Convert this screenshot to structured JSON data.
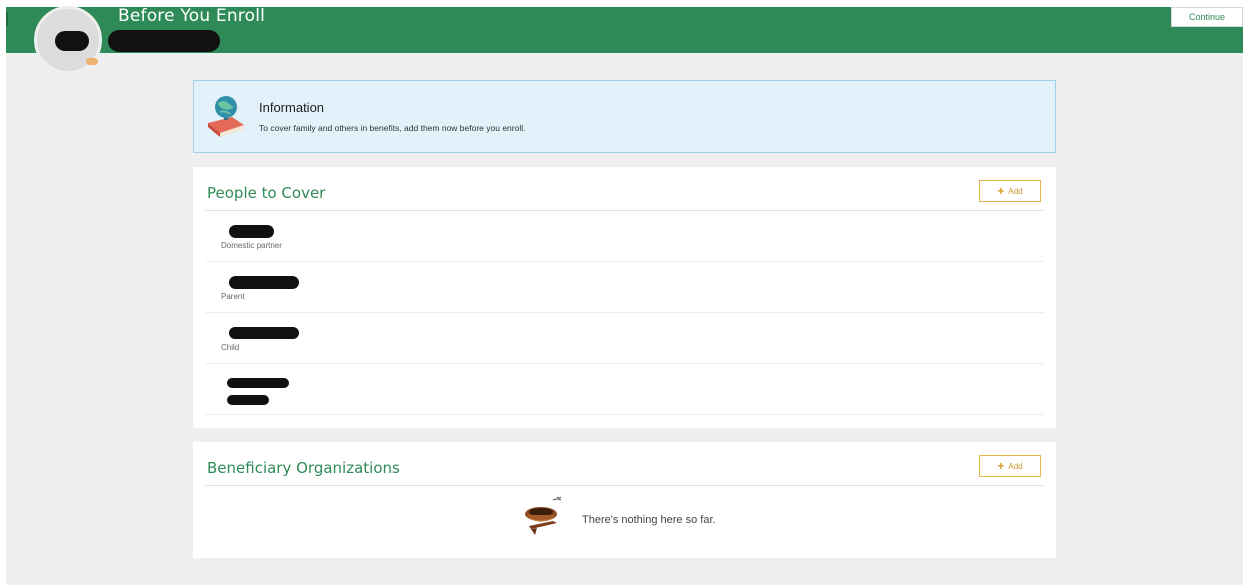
{
  "header": {
    "title": "Before You Enroll",
    "continue_label": "Continue",
    "brand_color": "#2e8b57"
  },
  "info": {
    "title": "Information",
    "text": "To cover family and others in benefits, add them now before you enroll."
  },
  "people_card": {
    "title": "People to Cover",
    "add_label": "Add",
    "people": [
      {
        "relation": "Domestic partner"
      },
      {
        "relation": "Parent"
      },
      {
        "relation": "Child"
      },
      {
        "relation": ""
      }
    ]
  },
  "beneficiary_card": {
    "title": "Beneficiary Organizations",
    "add_label": "Add",
    "empty_text": "There's nothing here so far."
  },
  "icons": {
    "info": "globe-on-book-icon",
    "empty": "empty-nest-icon",
    "add": "plus-icon"
  }
}
